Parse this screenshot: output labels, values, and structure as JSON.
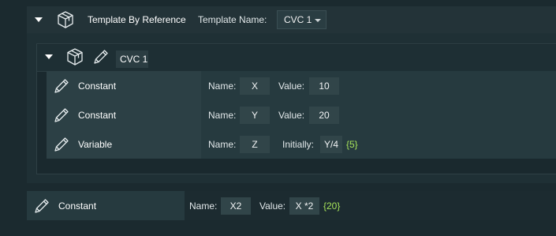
{
  "template_block": {
    "title": "Template By Reference",
    "template_name_label": "Template Name:",
    "template_name_value": "CVC 1",
    "icons": {
      "collapse": "caret-down-icon",
      "block": "cube-icon"
    }
  },
  "template_instance": {
    "title": "CVC 1",
    "icons": {
      "collapse": "caret-down-icon",
      "block": "cube-icon",
      "edit": "pencil-icon"
    },
    "rows": [
      {
        "kind": "Constant",
        "name_label": "Name:",
        "name": "X",
        "value_label": "Value:",
        "value": "10",
        "result": ""
      },
      {
        "kind": "Constant",
        "name_label": "Name:",
        "name": "Y",
        "value_label": "Value:",
        "value": "20",
        "result": ""
      },
      {
        "kind": "Variable",
        "name_label": "Name:",
        "name": "Z",
        "value_label": "Initially:",
        "value": "Y/4",
        "result": "{5}"
      }
    ]
  },
  "standalone_row": {
    "kind": "Constant",
    "name_label": "Name:",
    "name": "X2",
    "value_label": "Value:",
    "value": "X *2",
    "result": "{20}"
  },
  "colors": {
    "background": "#1b2a2f",
    "field": "#314549",
    "result_text": "#a6e35a"
  }
}
